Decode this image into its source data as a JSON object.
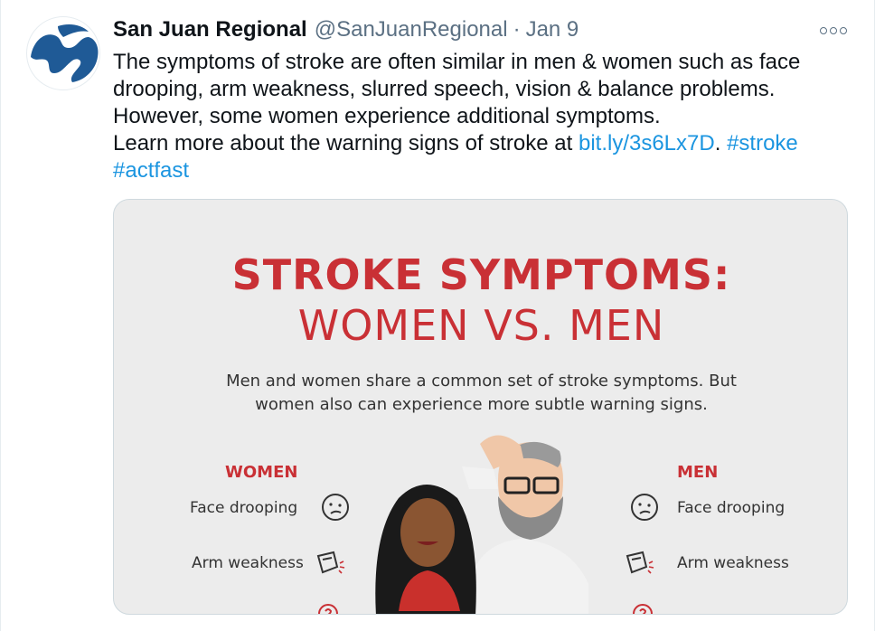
{
  "tweet": {
    "display_name": "San Juan Regional",
    "handle": "@SanJuanRegional",
    "separator": "·",
    "date": "Jan 9",
    "text_lines": [
      "The symptoms of stroke are often similar in men & women such as face",
      "drooping, arm weakness, slurred speech, vision & balance problems.",
      "However, some women experience additional symptoms."
    ],
    "learn_more_text": "Learn more about the warning signs of stroke at ",
    "link": "bit.ly/3s6Lx7D",
    "after_link": ". ",
    "hashtag1": "#stroke",
    "hashtag2": "#actfast"
  },
  "infographic": {
    "title_line1": "STROKE SYMPTOMS:",
    "title_line2": "WOMEN VS. MEN",
    "subtitle_line1": "Men and women share a common set of stroke symptoms. But",
    "subtitle_line2": "women also can experience more subtle warning signs.",
    "women_heading": "WOMEN",
    "men_heading": "MEN",
    "women_symptoms": [
      "Face drooping",
      "Arm weakness"
    ],
    "men_symptoms": [
      "Face drooping",
      "Arm weakness"
    ]
  },
  "colors": {
    "accent_red": "#c93035",
    "link_blue": "#1b95e0",
    "avatar_blue": "#1f5a96"
  },
  "icons": [
    "more-options-icon",
    "face-drooping-icon",
    "arm-weakness-icon",
    "speech-question-icon"
  ]
}
